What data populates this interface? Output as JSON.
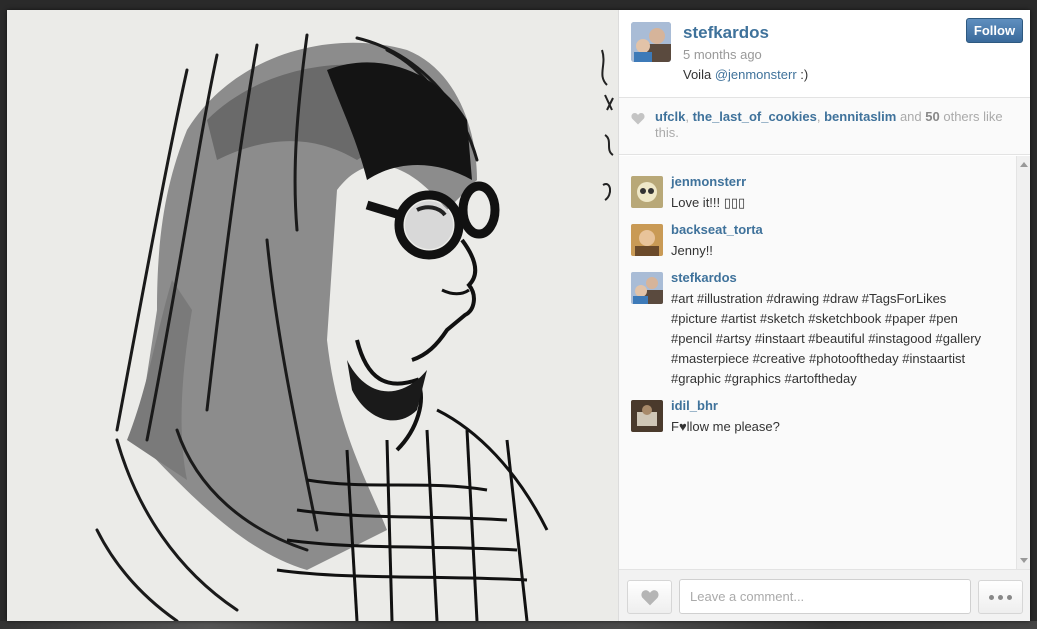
{
  "post": {
    "username": "stefkardos",
    "time_ago": "5 months ago",
    "caption_text": "Voila ",
    "caption_mention": "@jenmonsterr",
    "caption_suffix": " :)",
    "follow_label": "Follow"
  },
  "likes": {
    "users": [
      "ufclk",
      "the_last_of_cookies",
      "bennitaslim"
    ],
    "sep1": ", ",
    "sep2": ", ",
    "and_text": " and ",
    "count": "50",
    "suffix": " others like this."
  },
  "comments": [
    {
      "user": "jenmonsterr",
      "text": "Love it!!! ▯▯▯"
    },
    {
      "user": "backseat_torta",
      "text": "Jenny!!"
    },
    {
      "user": "stefkardos",
      "text": "#art #illustration #drawing #draw #TagsForLikes #picture #artist #sketch #sketchbook #paper #pen #pencil #artsy #instaart #beautiful #instagood #gallery #masterpiece #creative #photooftheday #instaartist #graphic #graphics #artoftheday"
    },
    {
      "user": "idil_bhr",
      "text": "F♥llow me please?"
    }
  ],
  "footer": {
    "comment_placeholder": "Leave a comment..."
  },
  "icons": {
    "like": "heart-icon",
    "more": "ellipsis-icon"
  },
  "colors": {
    "link": "#3f729b",
    "follow_button": "#4a7aab"
  }
}
